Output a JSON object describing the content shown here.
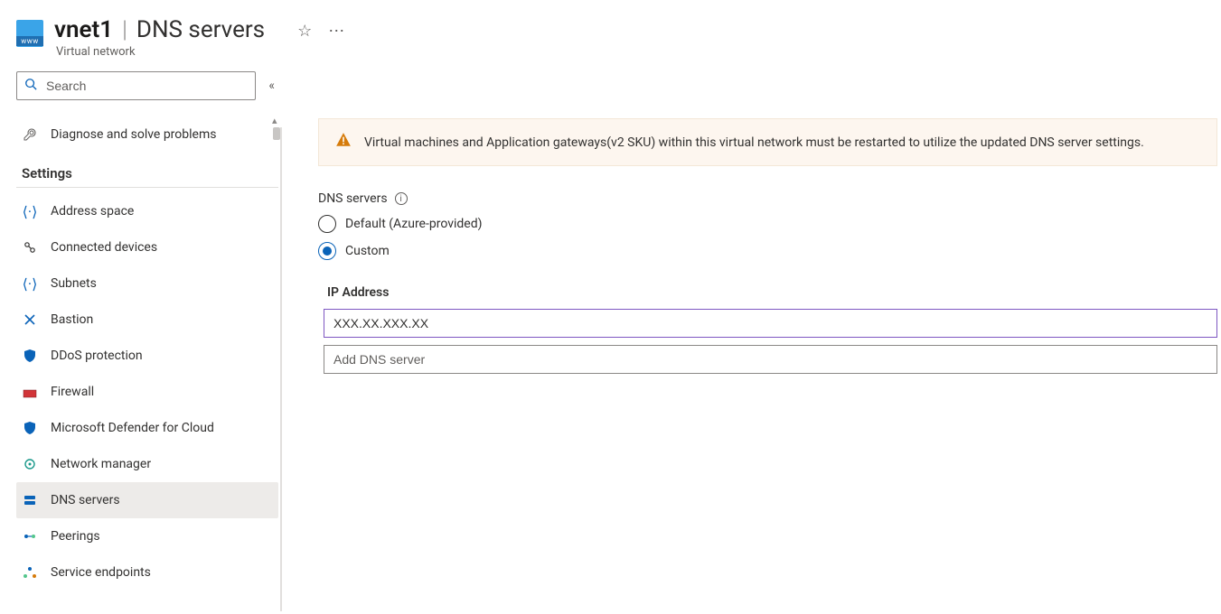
{
  "header": {
    "resource_name": "vnet1",
    "page_name": "DNS servers",
    "resource_type": "Virtual network"
  },
  "sidebar": {
    "search_placeholder": "Search",
    "diagnose_label": "Diagnose and solve problems",
    "settings_header": "Settings",
    "items": [
      {
        "label": "Address space"
      },
      {
        "label": "Connected devices"
      },
      {
        "label": "Subnets"
      },
      {
        "label": "Bastion"
      },
      {
        "label": "DDoS protection"
      },
      {
        "label": "Firewall"
      },
      {
        "label": "Microsoft Defender for Cloud"
      },
      {
        "label": "Network manager"
      },
      {
        "label": "DNS servers"
      },
      {
        "label": "Peerings"
      },
      {
        "label": "Service endpoints"
      }
    ]
  },
  "banner": {
    "text": "Virtual machines and Application gateways(v2 SKU) within this virtual network must be restarted to utilize the updated DNS server settings."
  },
  "dns": {
    "field_label": "DNS servers",
    "option_default": "Default (Azure-provided)",
    "option_custom": "Custom",
    "selected": "custom",
    "ip_heading": "IP Address",
    "ip_value": "XXX.XX.XXX.XX",
    "add_placeholder": "Add DNS server"
  }
}
